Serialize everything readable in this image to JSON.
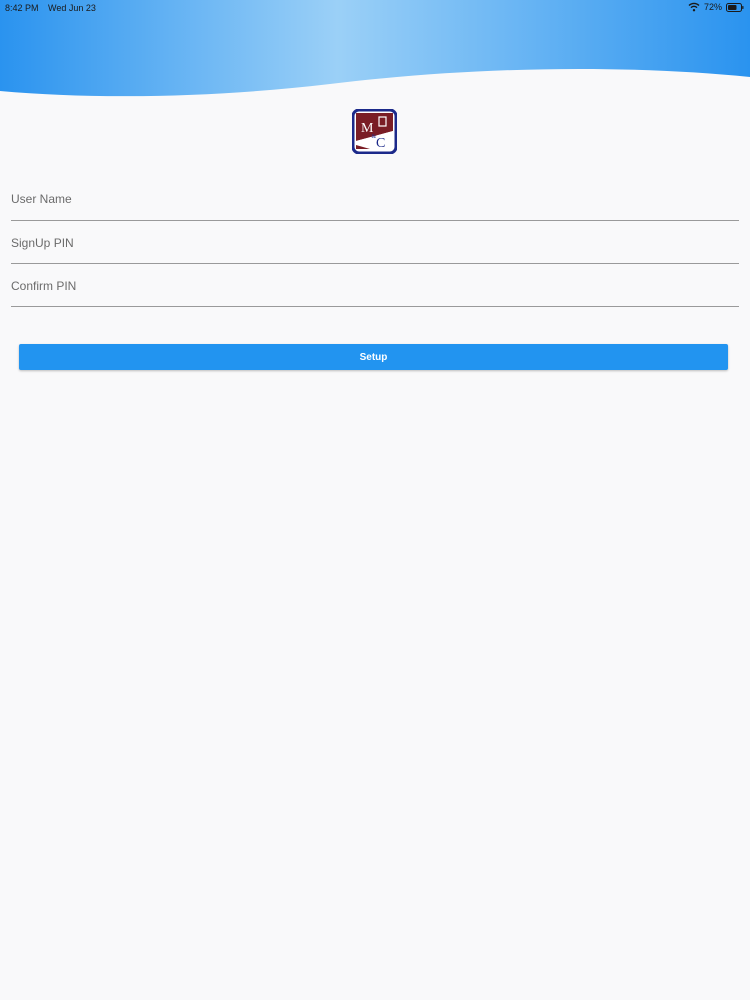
{
  "status_bar": {
    "time": "8:42 PM",
    "date": "Wed Jun 23",
    "battery": "72%"
  },
  "form": {
    "user_name_label": "User Name",
    "signup_pin_label": "SignUp PIN",
    "confirm_pin_label": "Confirm PIN",
    "setup_label": "Setup"
  },
  "logo": {
    "text_m": "M",
    "text_amp": "&",
    "text_c": "C"
  },
  "colors": {
    "accent": "#2294f0",
    "header_light": "#9bd0f7",
    "header_dark": "#2a93ef",
    "logo_border": "#1c2a8a",
    "logo_red": "#7a1d25"
  }
}
